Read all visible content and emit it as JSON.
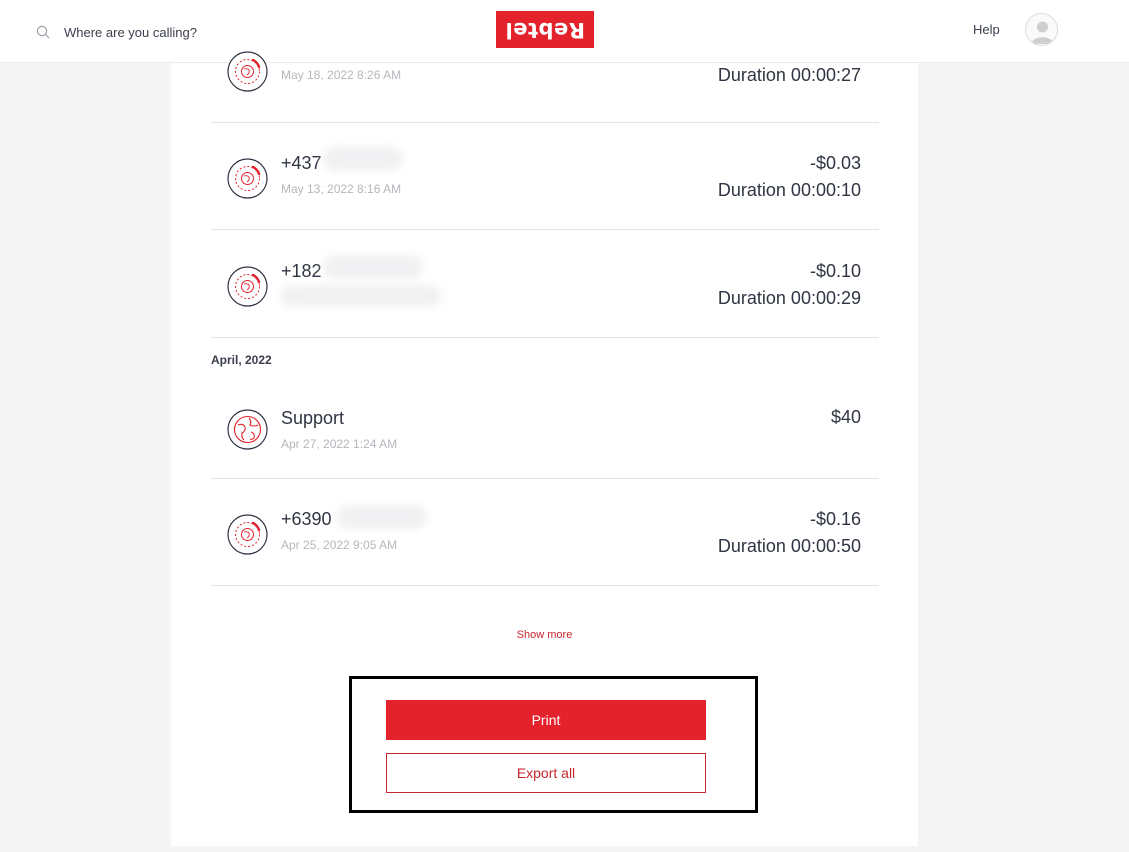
{
  "header": {
    "search_placeholder": "Where are you calling?",
    "logo_text": "Rebtel",
    "help_label": "Help"
  },
  "calls_before": [
    {
      "name": "",
      "date": "May 18, 2022 8:26 AM",
      "amount": "",
      "duration": "Duration 00:00:27"
    },
    {
      "name": "+437",
      "date": "May 13, 2022 8:16 AM",
      "amount": "-$0.03",
      "duration": "Duration 00:00:10"
    },
    {
      "name": "+182",
      "date": "",
      "amount": "-$0.10",
      "duration": "Duration 00:00:29"
    }
  ],
  "month_label": "April, 2022",
  "calls_april": [
    {
      "name": "Support",
      "date": "Apr 27, 2022 1:24 AM",
      "amount": "$40",
      "duration": ""
    },
    {
      "name": "+6390",
      "date": "Apr 25, 2022 9:05 AM",
      "amount": "-$0.16",
      "duration": "Duration 00:00:50"
    }
  ],
  "show_more_label": "Show more",
  "actions": {
    "print_label": "Print",
    "export_label": "Export all"
  },
  "colors": {
    "brand_red": "#e3222b",
    "link_red": "#c6262e",
    "text_dark": "#2f3542",
    "text_muted": "#b4b7bc"
  }
}
